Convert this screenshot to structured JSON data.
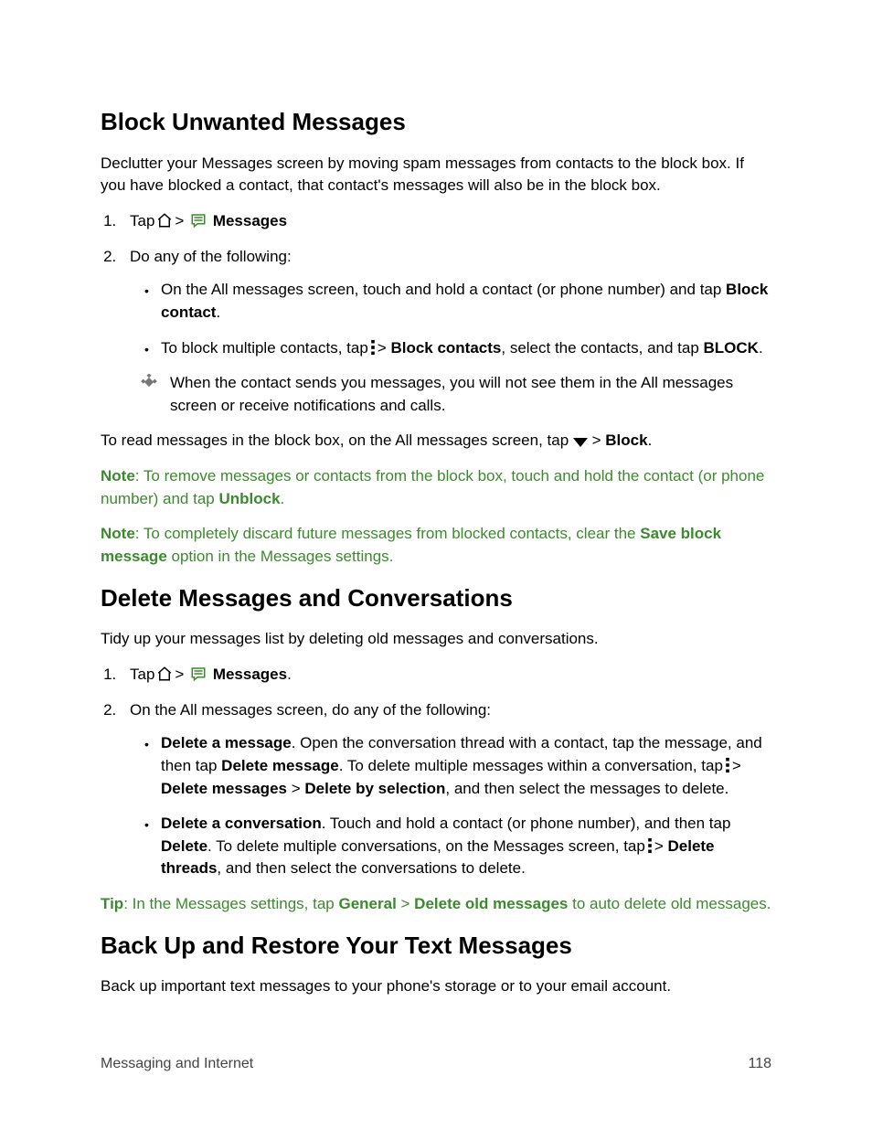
{
  "section1": {
    "heading": "Block Unwanted Messages",
    "intro": "Declutter your Messages screen by moving spam messages from contacts to the block box. If you have blocked a contact, that contact's messages will also be in the block box.",
    "step1_tap": "Tap",
    "step1_messages": "Messages",
    "step2_lead": "Do any of the following:",
    "bullet1_a": "On the All messages screen, touch and hold a contact (or phone number) and tap ",
    "bullet1_b": "Block contact",
    "bullet1_c": ".",
    "bullet2_a": "To block multiple contacts, tap",
    "bullet2_b": "Block contacts",
    "bullet2_c": ", select the contacts, and tap ",
    "bullet2_d": "BLOCK",
    "bullet2_e": ".",
    "tip": "When the contact sends you messages, you will not see them in the All messages screen or receive notifications and calls.",
    "readblock_a": "To read messages in the block box, on the All messages screen, tap ",
    "readblock_b": "Block",
    "readblock_c": ".",
    "note1_a": "Note",
    "note1_b": ": To remove messages or contacts from the block box, touch and hold the contact (or phone number) and tap ",
    "note1_c": "Unblock",
    "note1_d": ".",
    "note2_a": "Note",
    "note2_b": ": To completely discard future messages from blocked contacts, clear the ",
    "note2_c": "Save block message",
    "note2_d": " option in the Messages settings."
  },
  "section2": {
    "heading": "Delete Messages and Conversations",
    "intro": "Tidy up your messages list by deleting old messages and conversations.",
    "step1_tap": "Tap",
    "step1_messages": "Messages",
    "step1_period": ".",
    "step2_lead": "On the All messages screen, do any of the following:",
    "b1_a": "Delete a message",
    "b1_b": ". Open the conversation thread with a contact, tap the message, and then tap ",
    "b1_c": "Delete message",
    "b1_d": ". To delete multiple messages within a conversation, tap",
    "b1_e": "Delete messages",
    "b1_f": "Delete by selection",
    "b1_g": ", and then select the messages to delete.",
    "b2_a": "Delete a conversation",
    "b2_b": ". Touch and hold a contact (or phone number), and then tap ",
    "b2_c": "Delete",
    "b2_d": ". To delete multiple conversations, on the Messages screen, tap",
    "b2_e": "Delete threads",
    "b2_f": ", and then select the conversations to delete.",
    "tip_a": "Tip",
    "tip_b": ": In the Messages settings, tap ",
    "tip_c": "General",
    "tip_d": "Delete old messages",
    "tip_e": " to auto delete old messages."
  },
  "section3": {
    "heading": "Back Up and Restore Your Text Messages",
    "intro": "Back up important text messages to your phone's storage or to your email account."
  },
  "footer": {
    "left": "Messaging and Internet",
    "right": "118"
  },
  "colors": {
    "note_green": "#3c8a2e"
  },
  "icons": {
    "home": "home-icon",
    "messages_list": "messages-list-icon",
    "more_vert": "more-vert-icon",
    "dropdown": "chevron-down-icon",
    "diamond": "diamond-tip-icon"
  }
}
